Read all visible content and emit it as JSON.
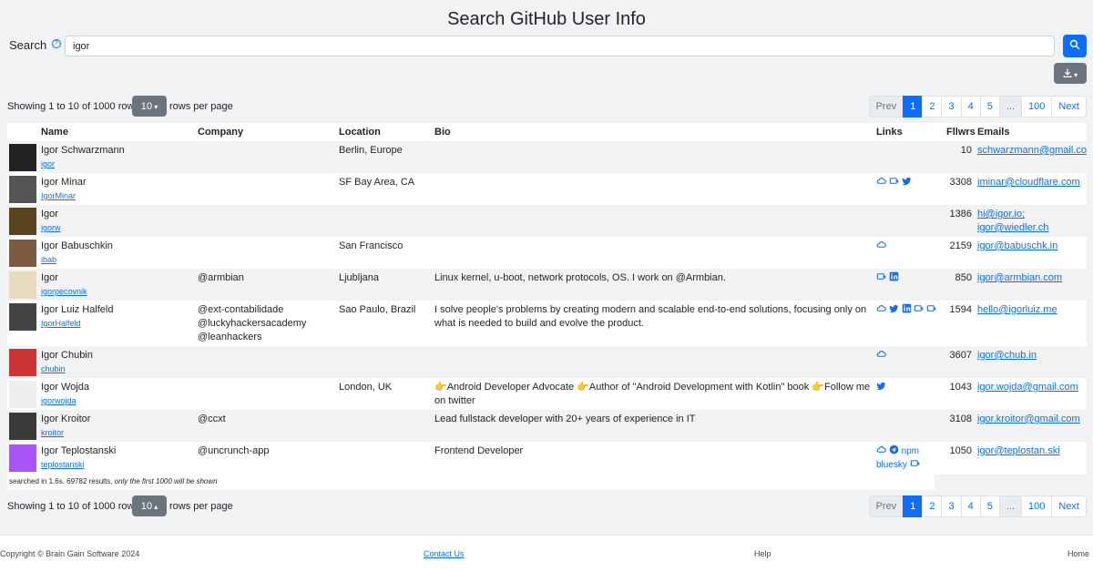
{
  "header": {
    "title": "Search GitHub User Info"
  },
  "search": {
    "label": "Search",
    "help_icon": "question-circle-icon",
    "value": "igor"
  },
  "toolbar": {
    "search_icon": "search-icon",
    "download_icon": "download-icon"
  },
  "pager": {
    "showing": "Showing 1 to 10 of 1000 rows",
    "rows_per_page": "10",
    "rows_per_page_label": "rows per page",
    "prev": "Prev",
    "next": "Next",
    "pages": [
      "1",
      "2",
      "3",
      "4",
      "5",
      "...",
      "100"
    ],
    "active_page": "1"
  },
  "table": {
    "columns": [
      "Name",
      "Company",
      "Location",
      "Bio",
      "Links",
      "Fllwrs",
      "Emails"
    ],
    "rows": [
      {
        "name": "Igor Schwarzmann",
        "login": "igor",
        "company": [],
        "location": "Berlin, Europe",
        "bio": "",
        "links": [],
        "followers": "10",
        "emails": [
          "schwarzmann@gmail.com"
        ],
        "avatar_color": "#222"
      },
      {
        "name": "Igor Minar",
        "login": "IgorMinar",
        "company": [],
        "location": "SF Bay Area, CA",
        "bio": "",
        "links": [
          "cloud-icon",
          "blog-icon",
          "twitter-icon"
        ],
        "followers": "3308",
        "emails": [
          "iminar@cloudflare.com"
        ],
        "avatar_color": "#555"
      },
      {
        "name": "Igor",
        "login": "igorw",
        "company": [],
        "location": "",
        "bio": "",
        "links": [],
        "followers": "1386",
        "emails": [
          "hi@igor.io;",
          "igor@wiedler.ch"
        ],
        "avatar_color": "#5a4420"
      },
      {
        "name": "Igor Babuschkin",
        "login": "ibab",
        "company": [],
        "location": "San Francisco",
        "bio": "",
        "links": [
          "cloud-icon"
        ],
        "followers": "2159",
        "emails": [
          "igor@babuschk.in"
        ],
        "avatar_color": "#7a5a40"
      },
      {
        "name": "Igor",
        "login": "igorpecovnik",
        "company": [
          "@armbian"
        ],
        "location": "Ljubljana",
        "bio": "Linux kernel, u-boot, network protocols, OS. I work on @Armbian.",
        "links": [
          "blog-icon",
          "linkedin-icon"
        ],
        "followers": "850",
        "emails": [
          "igor@armbian.com"
        ],
        "avatar_color": "#e8dcc0"
      },
      {
        "name": "Igor Luiz Halfeld",
        "login": "IgorHalfeld",
        "company": [
          "@ext-contabilidade",
          "@luckyhackersacademy",
          "@leanhackers"
        ],
        "location": "Sao Paulo, Brazil",
        "bio": "I solve people's problems by creating modern and scalable end-to-end solutions, focusing only on what is needed to build and evolve the product.",
        "links": [
          "cloud-icon",
          "twitter-icon",
          "linkedin-icon",
          "blog-icon",
          "blog-icon"
        ],
        "followers": "1594",
        "emails": [
          "hello@igorluiz.me"
        ],
        "avatar_color": "#444"
      },
      {
        "name": "Igor Chubin",
        "login": "chubin",
        "company": [],
        "location": "",
        "bio": "",
        "links": [
          "cloud-icon"
        ],
        "followers": "3607",
        "emails": [
          "igor@chub.in"
        ],
        "avatar_color": "#c33"
      },
      {
        "name": "Igor Wojda",
        "login": "igorwojda",
        "company": [],
        "location": "London, UK",
        "bio": "👉Android Developer Advocate 👉Author of \"Android Development with Kotlin\" book 👉Follow me on twitter",
        "links": [
          "twitter-icon"
        ],
        "followers": "1043",
        "emails": [
          "igor.wojda@gmail.com"
        ],
        "avatar_color": "#eee"
      },
      {
        "name": "Igor Kroitor",
        "login": "kroitor",
        "company": [
          "@ccxt"
        ],
        "location": "",
        "bio": "Lead fullstack developer with 20+ years of experience in IT",
        "links": [],
        "followers": "3108",
        "emails": [
          "igor.kroitor@gmail.com"
        ],
        "avatar_color": "#3a3a3a"
      },
      {
        "name": "Igor Teplostanski",
        "login": "teplostanski",
        "company": [
          "@uncrunch-app"
        ],
        "location": "",
        "bio": "Frontend Developer",
        "links": [
          "cloud-icon",
          "telegram-icon",
          "npm",
          "bluesky",
          "blog-icon"
        ],
        "followers": "1050",
        "emails": [
          "igor@teplostan.ski"
        ],
        "avatar_color": "#a855f7"
      }
    ]
  },
  "stats": {
    "prefix": "searched in 1.6s. 69782 results, ",
    "note": "only the first 1000 will be shown"
  },
  "footer": {
    "copyright": "Copyright © Brain Gain Software 2024",
    "contact": "Contact Us",
    "help": "Help",
    "home": "Home"
  }
}
